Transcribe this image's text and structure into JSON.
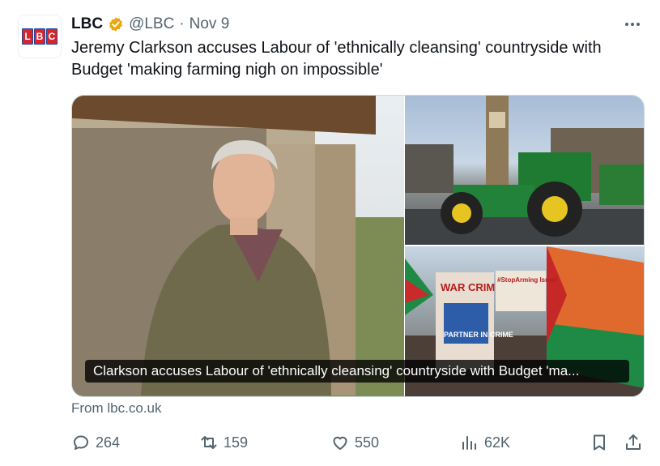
{
  "tweet": {
    "display_name": "LBC",
    "handle": "@LBC",
    "separator": "·",
    "date": "Nov 9",
    "text": "Jeremy Clarkson accuses Labour of 'ethnically cleansing' countryside with Budget 'making farming nigh on impossible'",
    "avatar_letters": [
      "L",
      "B",
      "C"
    ],
    "verified_color": "#e8a812"
  },
  "card": {
    "caption": "Clarkson accuses Labour of 'ethnically cleansing' countryside with Budget 'ma...",
    "source": "From lbc.co.uk",
    "sign_war_criminal": "WAR CRIMINAL",
    "sign_partner": "PARTNER IN CRIME",
    "sign_stop_arming": "#StopArming Israel"
  },
  "actions": {
    "replies": "264",
    "reposts": "159",
    "likes": "550",
    "views": "62K"
  },
  "colors": {
    "text": "#0f1419",
    "secondary": "#536471",
    "lbc_red": "#d9232d",
    "lbc_blue": "#1a4aa0"
  },
  "icons": [
    "reply-icon",
    "repost-icon",
    "like-icon",
    "views-icon",
    "bookmark-icon",
    "share-icon",
    "more-icon",
    "verified-icon"
  ]
}
